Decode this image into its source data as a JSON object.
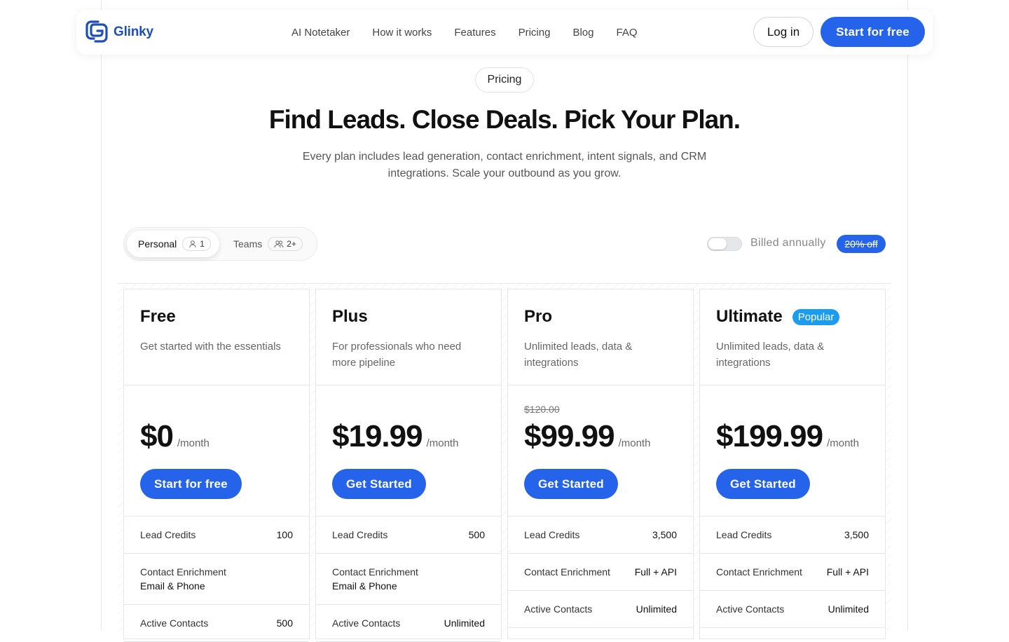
{
  "brand": {
    "name": "Glinky",
    "color": "#1e4fb8",
    "accent": "#2563eb"
  },
  "nav": {
    "links": [
      "AI Notetaker",
      "How it works",
      "Features",
      "Pricing",
      "Blog",
      "FAQ"
    ],
    "login": "Log in",
    "start": "Start for free"
  },
  "hero": {
    "pill": "Pricing",
    "title": "Find Leads. Close Deals. Pick Your Plan.",
    "subtitle": "Every plan includes lead generation, contact enrichment, intent signals, and CRM integrations. Scale your outbound as you grow."
  },
  "billing": {
    "tabs": [
      {
        "label": "Personal",
        "count": "1",
        "icon": "user-icon"
      },
      {
        "label": "Teams",
        "count": "2+",
        "icon": "users-icon"
      }
    ],
    "billed_label": "Billed annually",
    "discount": "20% off",
    "annual": false
  },
  "plans": [
    {
      "name": "Free",
      "badge": "",
      "desc": "Get started with the essentials",
      "old_price": "",
      "price": "$0",
      "per": "/month",
      "cta": "Start for free",
      "features": [
        {
          "label": "Lead Credits",
          "value": "100",
          "stacked": false
        },
        {
          "label": "Contact Enrichment",
          "value": "Email & Phone",
          "stacked": true
        },
        {
          "label": "Active Contacts",
          "value": "500",
          "stacked": false
        }
      ]
    },
    {
      "name": "Plus",
      "badge": "",
      "desc": "For professionals who need more pipeline",
      "old_price": "",
      "price": "$19.99",
      "per": "/month",
      "cta": "Get Started",
      "features": [
        {
          "label": "Lead Credits",
          "value": "500",
          "stacked": false
        },
        {
          "label": "Contact Enrichment",
          "value": "Email & Phone",
          "stacked": true
        },
        {
          "label": "Active Contacts",
          "value": "Unlimited",
          "stacked": false
        }
      ]
    },
    {
      "name": "Pro",
      "badge": "",
      "desc": "Unlimited leads, data & integrations",
      "old_price": "$120.00",
      "price": "$99.99",
      "per": "/month",
      "cta": "Get Started",
      "features": [
        {
          "label": "Lead Credits",
          "value": "3,500",
          "stacked": false
        },
        {
          "label": "Contact Enrichment",
          "value": "Full + API",
          "stacked": false
        },
        {
          "label": "Active Contacts",
          "value": "Unlimited",
          "stacked": false
        }
      ]
    },
    {
      "name": "Ultimate",
      "badge": "Popular",
      "desc": "Unlimited leads, data & integrations",
      "old_price": "",
      "price": "$199.99",
      "per": "/month",
      "cta": "Get Started",
      "features": [
        {
          "label": "Lead Credits",
          "value": "3,500",
          "stacked": false
        },
        {
          "label": "Contact Enrichment",
          "value": "Full + API",
          "stacked": false
        },
        {
          "label": "Active Contacts",
          "value": "Unlimited",
          "stacked": false
        }
      ]
    }
  ]
}
